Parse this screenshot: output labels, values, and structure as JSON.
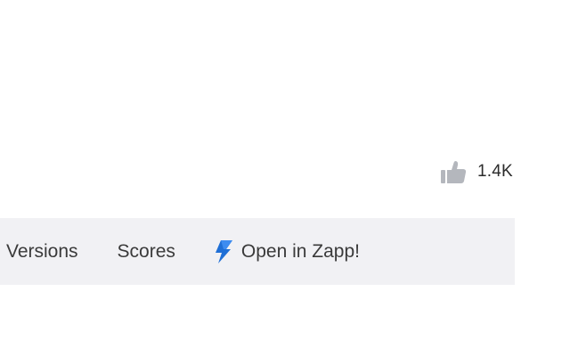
{
  "likes": {
    "icon": "thumbs-up-icon",
    "count": "1.4K",
    "icon_color": "#b4b7bd"
  },
  "tabs": {
    "versions_label": "Versions",
    "scores_label": "Scores",
    "open_in_zapp_label": "Open in Zapp!",
    "zapp_icon": "lightning-bolt-icon",
    "zapp_icon_color": "#1f6fd6"
  },
  "colors": {
    "tab_bar_background": "#f1f1f4",
    "text": "#3a3a3a"
  }
}
